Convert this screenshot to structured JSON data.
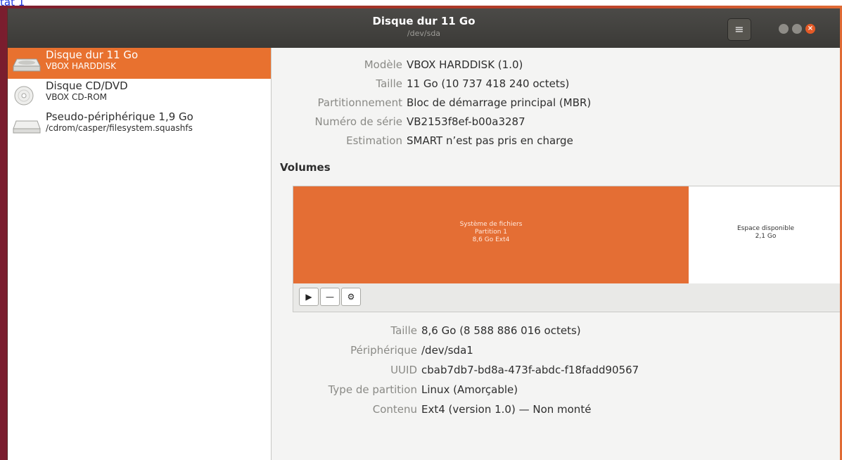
{
  "top_link": "tat 1",
  "window": {
    "title": "Disque dur 11 Go",
    "subtitle": "/dev/sda",
    "menu_icon": "hamburger-icon",
    "controls": [
      "minimize-icon",
      "maximize-icon",
      "close-icon"
    ]
  },
  "sidebar": {
    "devices": [
      {
        "name": "Disque dur 11 Go",
        "sub": "VBOX HARDDISK",
        "icon": "hard-disk-icon",
        "selected": true
      },
      {
        "name": "Disque CD/DVD",
        "sub": "VBOX CD-ROM",
        "icon": "optical-disc-icon",
        "selected": false
      },
      {
        "name": "Pseudo-périphérique 1,9 Go",
        "sub": "/cdrom/casper/filesystem.squashfs",
        "icon": "drive-icon",
        "selected": false
      }
    ]
  },
  "disk_info": [
    {
      "key": "Modèle",
      "value": "VBOX HARDDISK (1.0)"
    },
    {
      "key": "Taille",
      "value": "11 Go (10 737 418 240 octets)"
    },
    {
      "key": "Partitionnement",
      "value": "Bloc de démarrage principal (MBR)"
    },
    {
      "key": "Numéro de série",
      "value": "VB2153f8ef-b00a3287"
    },
    {
      "key": "Estimation",
      "value": "SMART n’est pas pris en charge"
    }
  ],
  "volumes": {
    "title": "Volumes",
    "partition": {
      "line1": "Système de fichiers",
      "line2": "Partition 1",
      "line3": "8,6 Go Ext4",
      "color": "#e46e34"
    },
    "free": {
      "line1": "Espace disponible",
      "line2": "2,1 Go"
    },
    "toolbar": {
      "play_icon": "play-icon",
      "minus_icon": "minus-icon",
      "gears_icon": "gears-icon"
    }
  },
  "partition_info": [
    {
      "key": "Taille",
      "value": "8,6 Go (8 588 886 016 octets)"
    },
    {
      "key": "Périphérique",
      "value": "/dev/sda1"
    },
    {
      "key": "UUID",
      "value": "cbab7db7-bd8a-473f-abdc-f18fadd90567"
    },
    {
      "key": "Type de partition",
      "value": "Linux (Amorçable)"
    },
    {
      "key": "Contenu",
      "value": "Ext4 (version 1.0) — Non monté"
    }
  ],
  "colors": {
    "accent": "#e8712f",
    "titlebar": "#3f3e3b"
  }
}
